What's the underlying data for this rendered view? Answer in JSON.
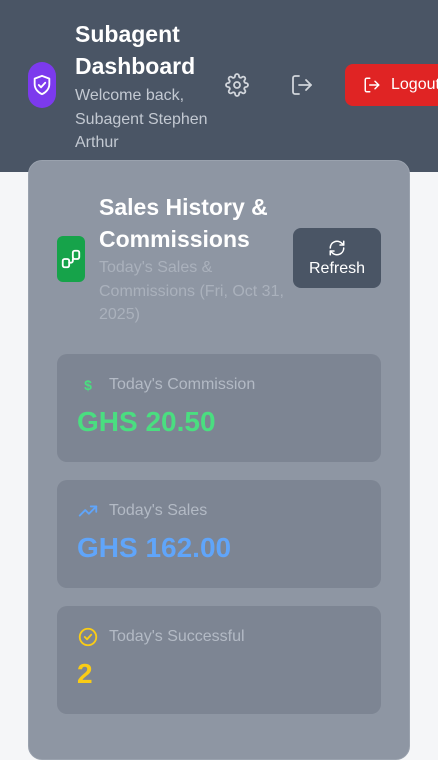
{
  "header": {
    "title": "Subagent Dashboard",
    "welcome": "Welcome back, Subagent Stephen Arthur",
    "logout_label": "Logout",
    "brand_icon": "shield-check-icon",
    "settings_icon": "gear-icon",
    "exit_icon": "sign-out-icon"
  },
  "panel": {
    "title": "Sales History & Commissions",
    "subtitle": "Today's Sales & Commissions (Fri, Oct 31, 2025)",
    "refresh_label": "Refresh",
    "icon": "chart-icon"
  },
  "stats": [
    {
      "label": "Today's Commission",
      "value": "GHS 20.50",
      "color": "#4ade80",
      "icon": "dollar-icon"
    },
    {
      "label": "Today's Sales",
      "value": "GHS 162.00",
      "color": "#60a5fa",
      "icon": "trending-up-icon"
    },
    {
      "label": "Today's Successful",
      "value": "2",
      "color": "#facc15",
      "icon": "check-circle-icon"
    }
  ],
  "colors": {
    "header_bg": "#4a5565",
    "logout_bg": "#e02424",
    "brand_purple": "#7c3aed",
    "panel_icon_green": "#16a34a"
  }
}
